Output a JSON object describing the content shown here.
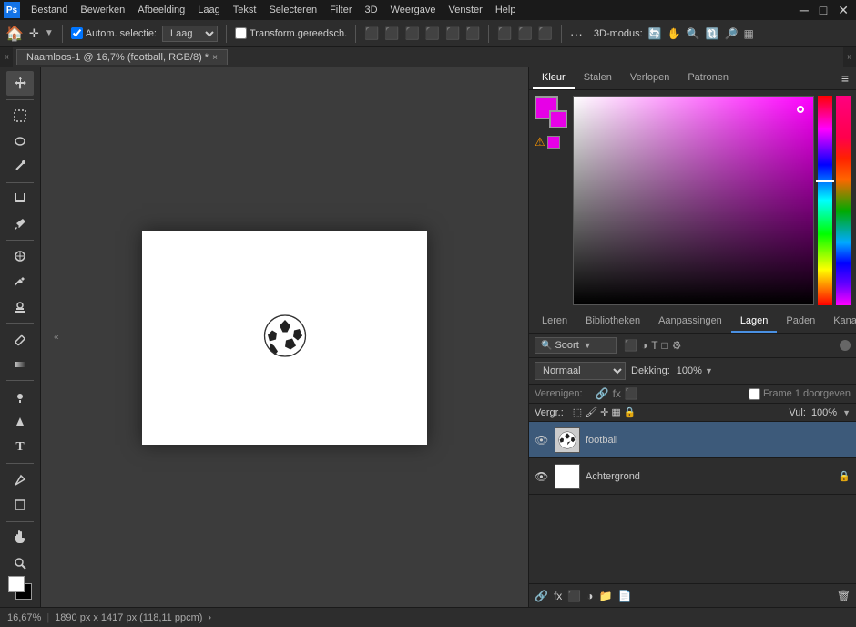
{
  "app": {
    "title": "Adobe Photoshop",
    "ps_icon": "Ps"
  },
  "menu": {
    "items": [
      "Bestand",
      "Bewerken",
      "Afbeelding",
      "Laag",
      "Tekst",
      "Selecteren",
      "Filter",
      "3D",
      "Weergave",
      "Venster",
      "Help"
    ]
  },
  "options_bar": {
    "move_icon": "✛",
    "auto_select_label": "Autom. selectie:",
    "auto_select_value": "Laag",
    "transform_label": "Transform.gereedsch.",
    "align_icons": [
      "⊞",
      "⊟",
      "⊠",
      "⊡"
    ],
    "three_d_label": "3D-modus:",
    "dots": "···"
  },
  "tab": {
    "title": "Naamloos-1 @ 16,7% (football, RGB/8) *",
    "close": "×"
  },
  "toolbar": {
    "tools": [
      "↖",
      "⬚",
      "✦",
      "✏",
      "⬛",
      "⬡",
      "✂",
      "📎",
      "🖊",
      "🔍",
      "🖐",
      "⬜"
    ]
  },
  "color_panel": {
    "tabs": [
      "Kleur",
      "Stalen",
      "Verlopen",
      "Patronen"
    ],
    "active_tab": "Kleur"
  },
  "layers_panel": {
    "tabs": [
      "Leren",
      "Bibliotheken",
      "Aanpassingen",
      "Lagen",
      "Paden",
      "Kanalen"
    ],
    "active_tab": "Lagen",
    "filter_label": "Soort",
    "blend_mode": "Normaal",
    "opacity_label": "Dekking:",
    "opacity_value": "100%",
    "fill_label": "Vul:",
    "fill_value": "100%",
    "merge_label": "Verenigen:",
    "frame_label": "Frame 1 doorgeven",
    "layers": [
      {
        "name": "football",
        "visible": true,
        "selected": true,
        "has_thumbnail": true,
        "locked": false
      },
      {
        "name": "Achtergrond",
        "visible": true,
        "selected": false,
        "has_thumbnail": false,
        "locked": true
      }
    ]
  },
  "status_bar": {
    "zoom": "16,67%",
    "dimensions": "1890 px x 1417 px (118,11 ppcm)",
    "arrow": "›"
  }
}
